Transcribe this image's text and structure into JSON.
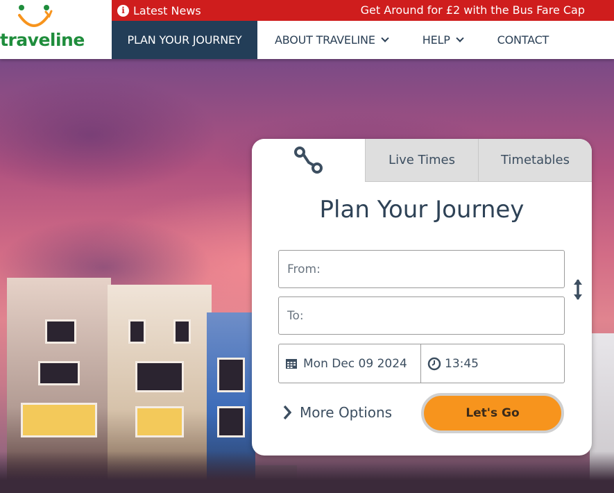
{
  "logo": {
    "text": "traveline"
  },
  "newsbar": {
    "label": "Latest News",
    "headline": "Get Around for £2 with the Bus Fare Cap"
  },
  "nav": {
    "items": [
      {
        "label": "PLAN YOUR JOURNEY"
      },
      {
        "label": "ABOUT TRAVELINE"
      },
      {
        "label": "HELP"
      },
      {
        "label": "CONTACT"
      }
    ]
  },
  "journey": {
    "tabs": [
      {
        "icon": "route-icon"
      },
      {
        "label": "Live Times"
      },
      {
        "label": "Timetables"
      }
    ],
    "title": "Plan Your Journey",
    "from_placeholder": "From:",
    "to_placeholder": "To:",
    "date": "Mon Dec 09 2024",
    "time": "13:45",
    "more_options": "More Options",
    "submit": "Let's Go"
  },
  "colors": {
    "brand_green": "#1f8d3c",
    "news_red": "#cf1d1d",
    "nav_active": "#233e58",
    "accent_orange": "#f7941d"
  }
}
